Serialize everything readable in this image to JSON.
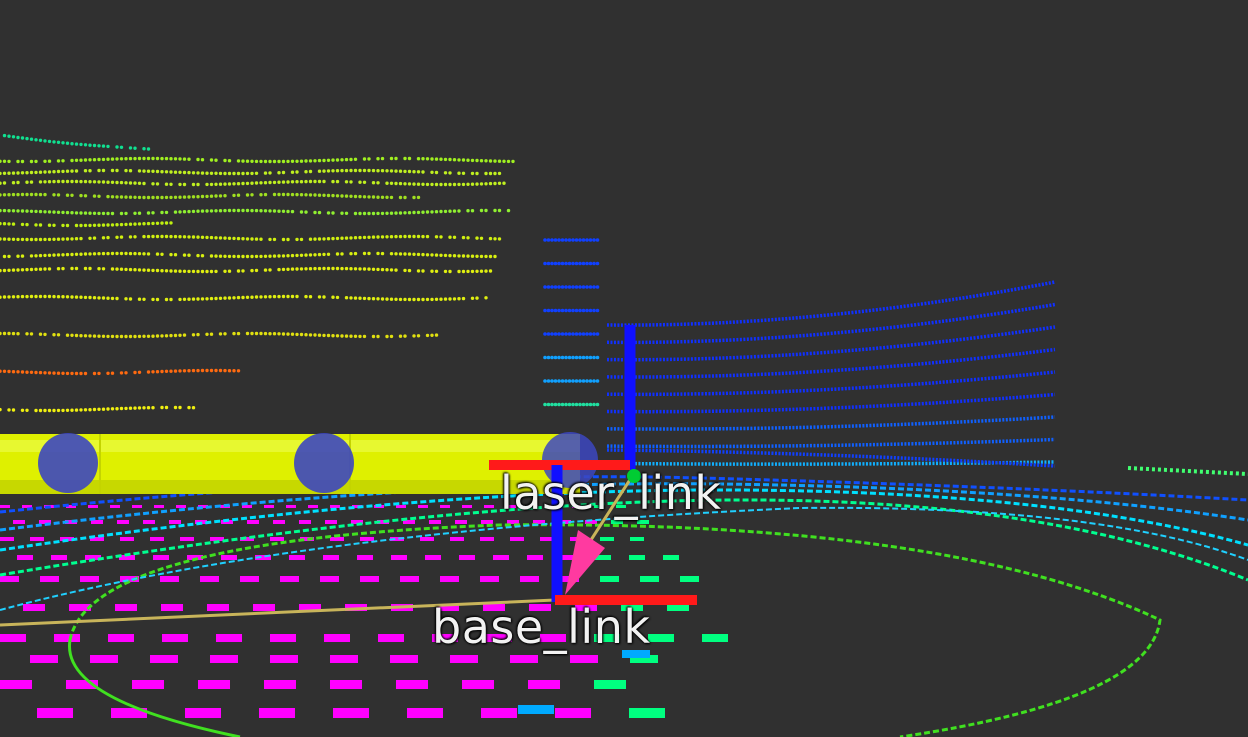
{
  "scene": {
    "background": "#303030",
    "tf_frames": [
      {
        "label": "laser_link",
        "key": "laser"
      },
      {
        "label": "base_link",
        "key": "base"
      }
    ],
    "colors": {
      "x_axis": "#ff1a1a",
      "y_axis": "#00cc33",
      "z_axis": "#1010ff",
      "tf_link_line": "#c8b45a",
      "tf_arrow": "#ff3aa0",
      "robot_body": "#ddf000",
      "robot_sphere": "#3c46c0",
      "grid_points": "#ff00ff",
      "scan_near": "#00ff20",
      "scan_far": "#1030ff"
    }
  }
}
